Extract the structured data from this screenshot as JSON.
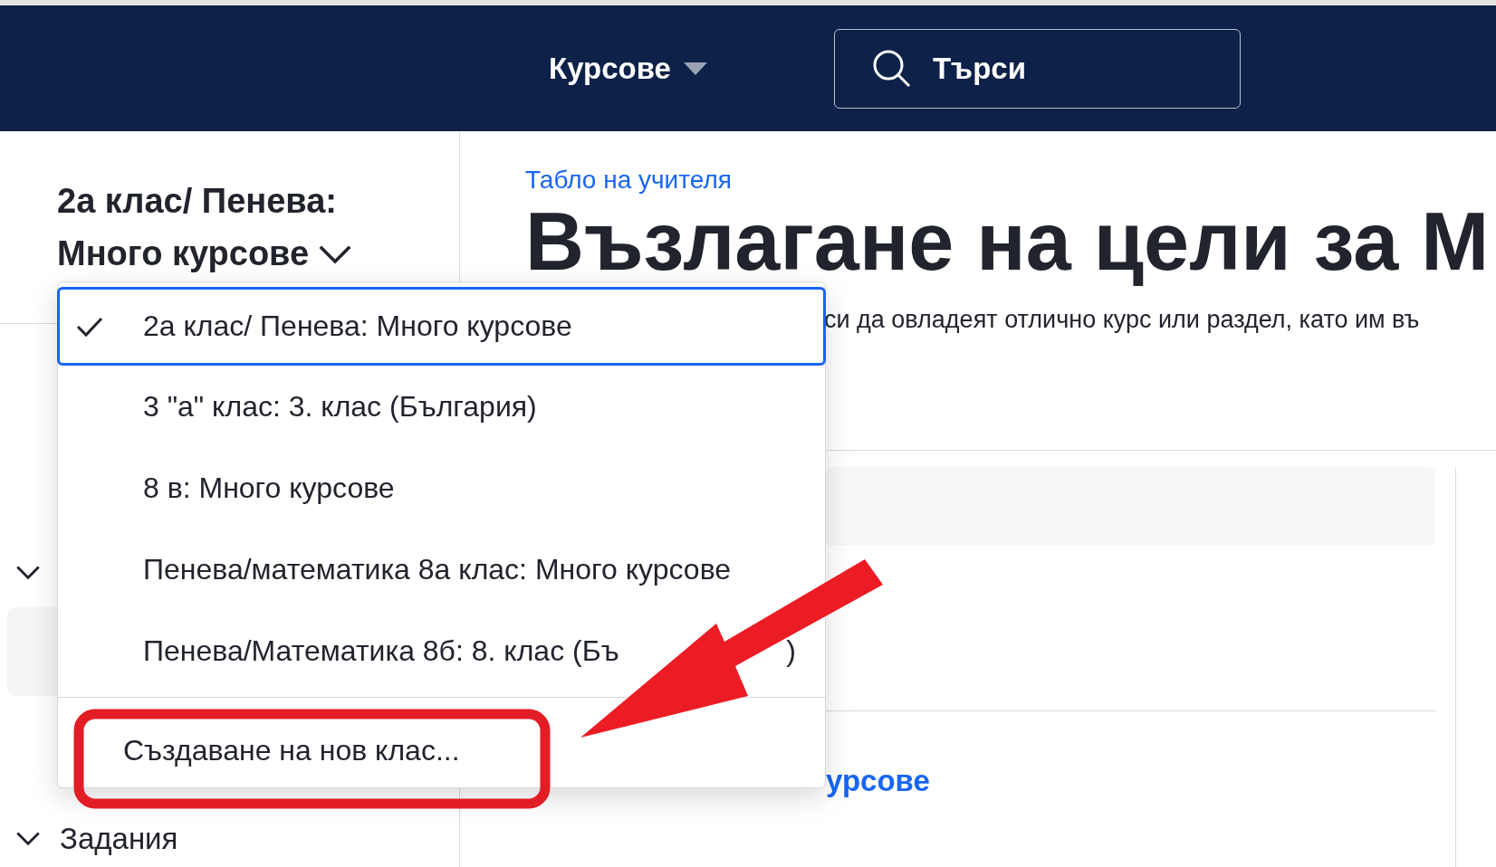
{
  "header": {
    "nav_label": "Курсове",
    "search": {
      "placeholder": "Търси"
    }
  },
  "sidebar": {
    "class_title": "2а клас/ Пенева: Много курсове",
    "sections": [
      {
        "expanded": true,
        "children": [
          {
            "selected": true
          }
        ]
      },
      {
        "label": "Задания",
        "expanded": true
      }
    ]
  },
  "main": {
    "breadcrumb": "Табло на учителя",
    "title": "Възлагане на цели за М",
    "description": "си да овладеят отлично курс или раздел, като им въ",
    "link": "урсове"
  },
  "class_menu": {
    "items": [
      {
        "label": "2а клас/ Пенева: Много курсове",
        "selected": true
      },
      {
        "label": "3 \"а\" клас: 3. клас (България)",
        "selected": false
      },
      {
        "label": "8 в: Много курсове",
        "selected": false
      },
      {
        "label": "Пенева/математика 8а клас: Много курсове",
        "selected": false
      },
      {
        "label": "Пенева/Математика 8б: 8. клас (Бъ",
        "label_end": ")",
        "selected": false
      }
    ],
    "create_label": "Създаване на нов клас..."
  }
}
